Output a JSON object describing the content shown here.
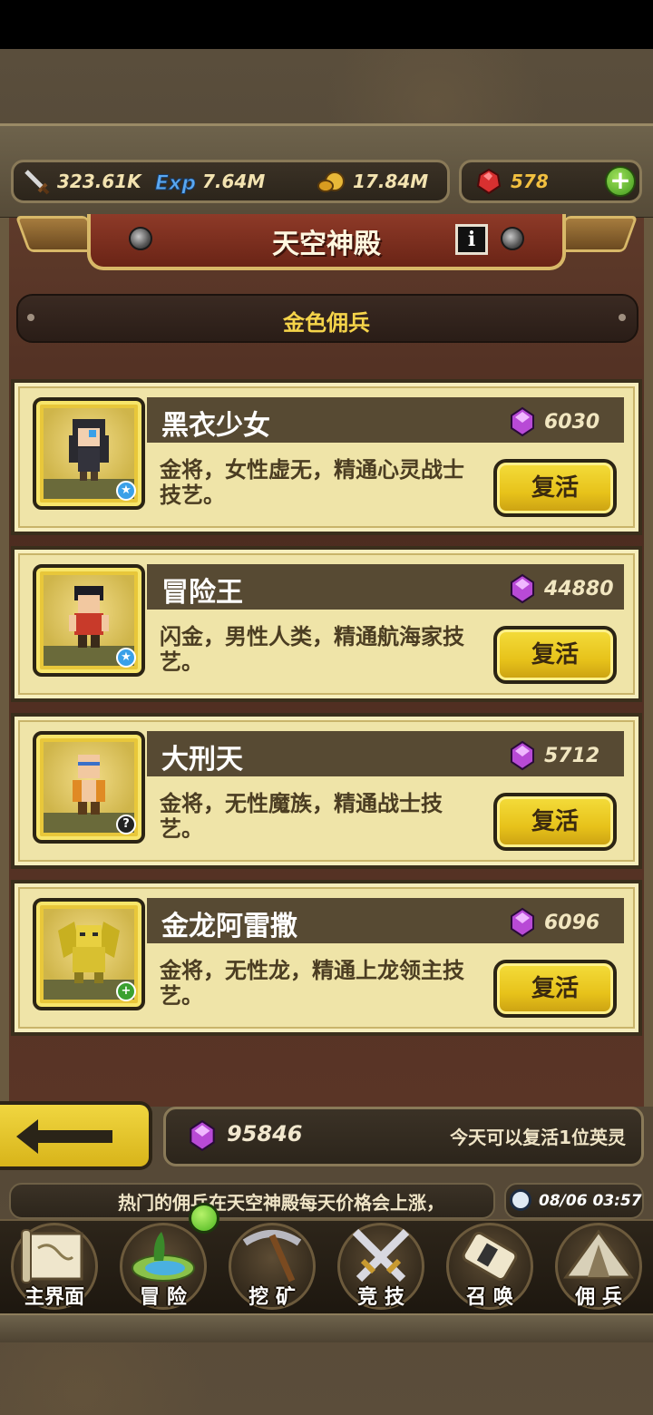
{
  "resources": {
    "attack": "323.61K",
    "exp": "7.64M",
    "gold": "17.84M",
    "gems": "578",
    "add_label": "+"
  },
  "header": {
    "title": "天空神殿",
    "info_label": "i",
    "subtitle": "金色佣兵"
  },
  "heroes": [
    {
      "name": "黑衣少女",
      "price": "6030",
      "desc": "金将，女性虚无，精通心灵战士技艺。",
      "button": "复活",
      "badge": "★"
    },
    {
      "name": "冒险王",
      "price": "44880",
      "desc": "闪金，男性人类，精通航海家技艺。",
      "button": "复活",
      "badge": "★"
    },
    {
      "name": "大刑天",
      "price": "5712",
      "desc": "金将，无性魔族，精通战士技艺。",
      "button": "复活",
      "badge": "?"
    },
    {
      "name": "金龙阿雷撒",
      "price": "6096",
      "desc": "金将，无性龙，精通上龙领主技艺。",
      "button": "复活",
      "badge": "+"
    }
  ],
  "footer": {
    "gem_total": "95846",
    "revive_note": "今天可以复活1位英灵",
    "ticker": "热门的佣兵在天空神殿每天价格会上涨，",
    "clock": "08/06 03:57"
  },
  "nav": [
    {
      "label": "主界面",
      "icon": "map-scroll-icon"
    },
    {
      "label": "冒 险",
      "icon": "island-icon"
    },
    {
      "label": "挖 矿",
      "icon": "pickaxe-icon"
    },
    {
      "label": "竞 技",
      "icon": "crossed-swords-icon"
    },
    {
      "label": "召 唤",
      "icon": "summon-scroll-icon"
    },
    {
      "label": "佣 兵",
      "icon": "tent-icon"
    }
  ],
  "colors": {
    "card_bg": "#efe4a8",
    "button_yellow": "#e7c21a",
    "banner_red": "#8e3a28",
    "subtitle_gold": "#f5d44a"
  }
}
